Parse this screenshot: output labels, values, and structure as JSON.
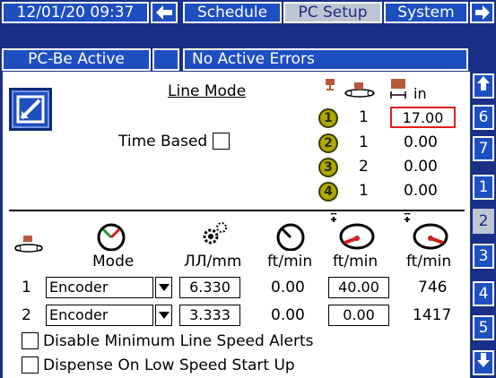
{
  "topbar": {
    "datetime": "12/01/20 09:37",
    "back_arrow": "🡸",
    "tabs": [
      "Schedule",
      "PC Setup",
      "System"
    ],
    "selected_tab": "PC Setup",
    "forward_arrow": "🡺"
  },
  "status": {
    "pc_state": "PC-Be Active",
    "errors": "No Active Errors"
  },
  "side_tabs": {
    "up": "🡹",
    "items": [
      "6",
      "7",
      "1",
      "2",
      "3",
      "4",
      "5"
    ],
    "selected": "2",
    "down": "🡻"
  },
  "line_mode": {
    "title": "Line Mode",
    "time_based_label": "Time Based",
    "time_based_checked": false,
    "unit_in": "in",
    "rows": [
      {
        "num": "1",
        "mult": "1",
        "value": "17.00",
        "editable": true
      },
      {
        "num": "2",
        "mult": "1",
        "value": "0.00"
      },
      {
        "num": "3",
        "mult": "2",
        "value": "0.00"
      },
      {
        "num": "4",
        "mult": "1",
        "value": "0.00"
      }
    ]
  },
  "encoders": {
    "headers": {
      "mode": "Mode",
      "pulse": "ЛЛ/mm",
      "ftmin1": "ft/min",
      "ftmin2": "ft/min",
      "ftmin3": "ft/min"
    },
    "rows": [
      {
        "index": "1",
        "mode": "Encoder",
        "pulses": "6.330",
        "speed": "0.00",
        "min_speed": "40.00",
        "max_speed": "746"
      },
      {
        "index": "2",
        "mode": "Encoder",
        "pulses": "3.333",
        "speed": "0.00",
        "min_speed": "0.00",
        "max_speed": "1417"
      }
    ]
  },
  "options": {
    "disable_alerts": "Disable Minimum Line Speed Alerts",
    "dispense_low_speed": "Dispense On Low Speed Start Up"
  },
  "colors": {
    "nav_dark": "#1a2f86",
    "nav_button": "#1d4fc0",
    "selected": "#bfc6d3",
    "highlight": "#e02020",
    "gun_badge": "#b1a800"
  }
}
